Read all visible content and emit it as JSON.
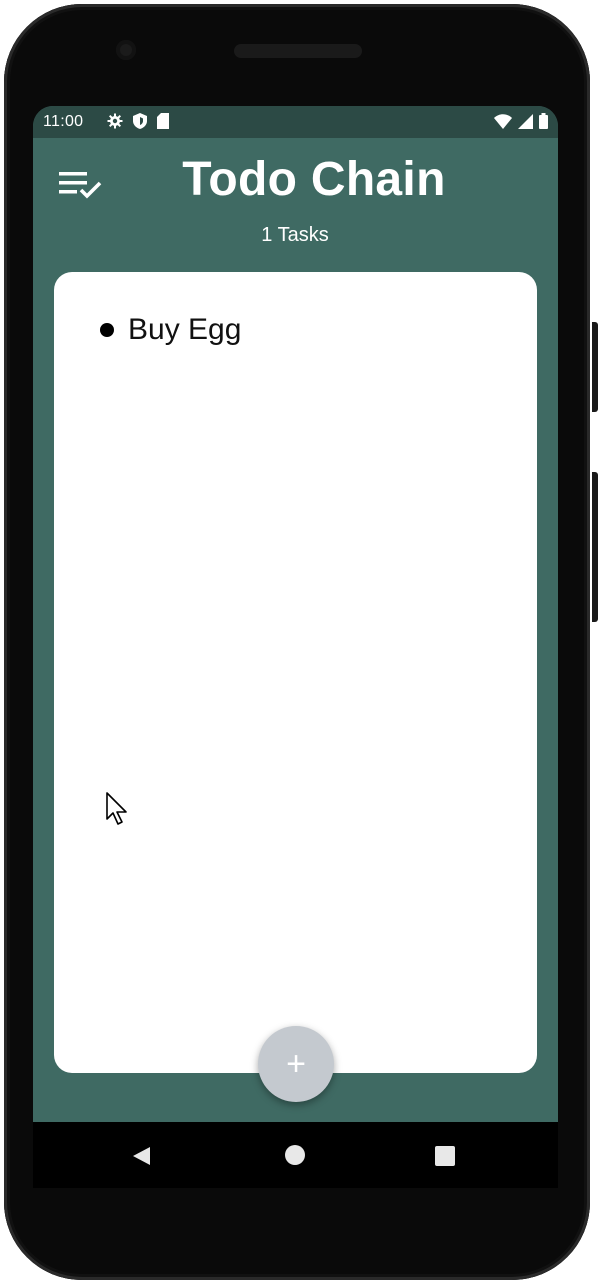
{
  "status_bar": {
    "time": "11:00",
    "icons_left": [
      "settings-gear-icon",
      "shield-icon",
      "sd-card-icon"
    ],
    "icons_right": [
      "wifi-icon",
      "signal-icon",
      "battery-icon"
    ]
  },
  "app_bar": {
    "menu_icon": "list-check-icon",
    "title": "Todo Chain",
    "task_count": "1 Tasks"
  },
  "tasks": [
    {
      "text": "Buy Egg"
    }
  ],
  "fab": {
    "icon": "plus-icon",
    "label": "+"
  },
  "nav_bar": {
    "icons": [
      "back-triangle-icon",
      "home-circle-icon",
      "recents-square-icon"
    ]
  },
  "colors": {
    "app_background": "#3f6a63",
    "status_bar": "#2c4a45",
    "card": "#ffffff",
    "fab": "#c4c9cf",
    "text_on_primary": "#ffffff"
  }
}
